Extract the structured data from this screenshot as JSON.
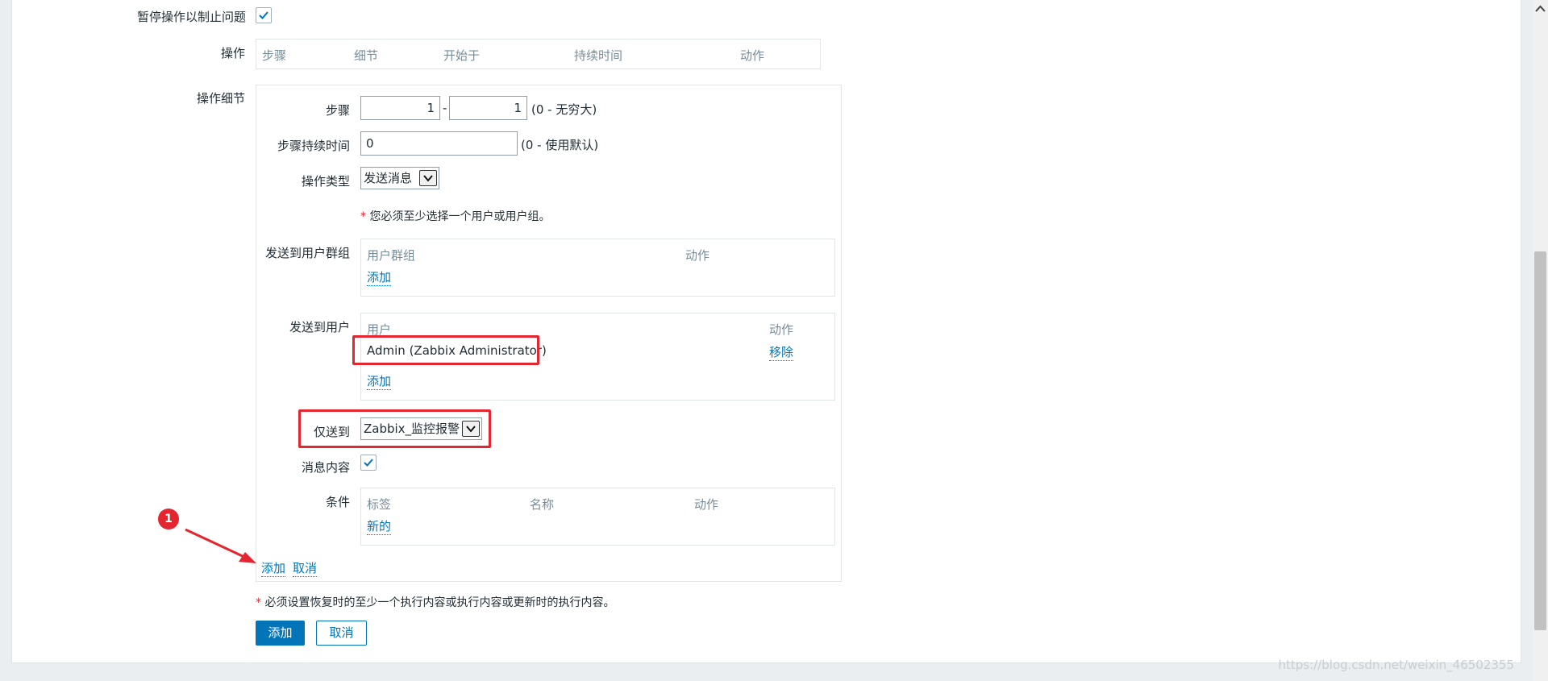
{
  "form": {
    "pause_label": "暂停操作以制止问题",
    "pause_checked": true,
    "operations_label": "操作",
    "operations_table": {
      "headers": [
        "步骤",
        "细节",
        "开始于",
        "持续时间",
        "动作"
      ]
    },
    "details_label": "操作细节"
  },
  "details": {
    "step_label": "步骤",
    "step_from": "1",
    "step_dash": "-",
    "step_to": "1",
    "step_hint": "(0 - 无穷大)",
    "duration_label": "步骤持续时间",
    "duration_value": "0",
    "duration_hint": "(0 - 使用默认)",
    "optype_label": "操作类型",
    "optype_value": "发送消息",
    "must_select_note": "您必须至少选择一个用户或用户组。",
    "usergroups_label": "发送到用户群组",
    "usergroups_table": {
      "col1": "用户群组",
      "col2": "动作",
      "add": "添加"
    },
    "users_label": "发送到用户",
    "users_table": {
      "col1": "用户",
      "col2": "动作",
      "rows": [
        {
          "name": "Admin (Zabbix Administrator)",
          "action": "移除"
        }
      ],
      "add": "添加"
    },
    "sendonly_label": "仅送到",
    "sendonly_value": "Zabbix_监控报警",
    "message_label": "消息内容",
    "message_checked": true,
    "conditions_label": "条件",
    "conditions_table": {
      "col1": "标签",
      "col2": "名称",
      "col3": "动作",
      "new": "新的"
    },
    "add_link": "添加",
    "cancel_link": "取消"
  },
  "footer": {
    "recovery_note": "必须设置恢复时的至少一个执行内容或执行内容或更新时的执行内容。",
    "add_button": "添加",
    "cancel_button": "取消"
  },
  "annotation": {
    "badge": "1"
  },
  "watermark": "https://blog.csdn.net/weixin_46502355",
  "colors": {
    "accent": "#0275b8",
    "highlight": "#e3262f",
    "muted": "#768d99"
  }
}
